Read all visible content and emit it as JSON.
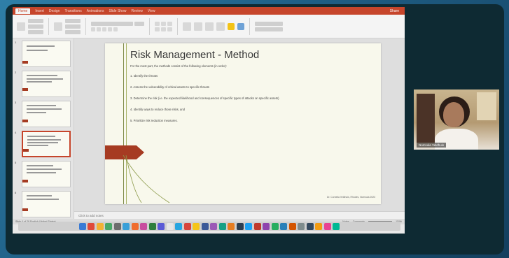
{
  "ribbon": {
    "tabs": [
      "Home",
      "Insert",
      "Design",
      "Transitions",
      "Animations",
      "Slide Show",
      "Review",
      "View"
    ],
    "active_tab": "Home",
    "share_label": "Share"
  },
  "slide": {
    "title": "Risk Management - Method",
    "intro": "For the most part, the methods consist of the following elements (in order):",
    "items": [
      "1. Identify the threats",
      "2. Assess the vulnerability of critical assets to specific threats",
      "3. Determine the risk (i.e. the expected likelihood and consequences of specific types of attacks on specific assets)",
      "4. Identify ways to reduce those risks, and",
      "5. Prioritize risk reduction measures."
    ],
    "footer": "Dr. Cornelia Veldhuis, Rhodes, Nomvula 2023"
  },
  "notes": {
    "placeholder": "Click to add notes"
  },
  "status": {
    "left": "Slide 4 of 26   English (United States)",
    "notes": "Notes",
    "comments": "Comments",
    "zoom": "118%"
  },
  "dock": {
    "icon_colors": [
      "#3a7bd5",
      "#e04a3a",
      "#f2b233",
      "#48a867",
      "#6d6d6d",
      "#3aa0d8",
      "#f06c2c",
      "#c84b9e",
      "#2f7e3d",
      "#5a5ad6",
      "#e6e6e6",
      "#27a5e0",
      "#d8443a",
      "#f5c518",
      "#3b5998",
      "#9b59b6",
      "#16a085",
      "#e67e22",
      "#2c3e50",
      "#1da1f2",
      "#c0392b",
      "#8e44ad",
      "#27ae60",
      "#2980b9",
      "#d35400",
      "#7f8c8d",
      "#34495e",
      "#f39c12",
      "#e84393",
      "#00b894"
    ]
  },
  "webcam": {
    "name_label": "Nomvula Veldhuis"
  }
}
